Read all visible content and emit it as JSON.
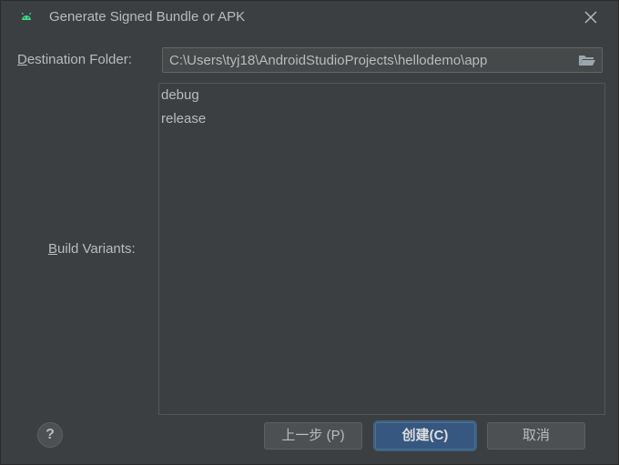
{
  "window": {
    "title": "Generate Signed Bundle or APK",
    "icon": "android-icon",
    "close_icon": "close-icon"
  },
  "destination": {
    "label_mnemonic": "D",
    "label_rest": "estination Folder:",
    "path": "C:\\Users\\tyj18\\AndroidStudioProjects\\hellodemo\\app",
    "browse_icon": "folder-open-icon"
  },
  "variants": {
    "label_mnemonic": "B",
    "label_rest": "uild Variants:",
    "items": [
      "debug",
      "release"
    ]
  },
  "footer": {
    "help_label": "?",
    "prev_label": "上一步 (P)",
    "create_label": "创建(C)",
    "cancel_label": "取消"
  },
  "colors": {
    "background": "#3c3f41",
    "text": "#bbbbbb",
    "android_green": "#3ddc84",
    "primary_button": "#365880"
  }
}
